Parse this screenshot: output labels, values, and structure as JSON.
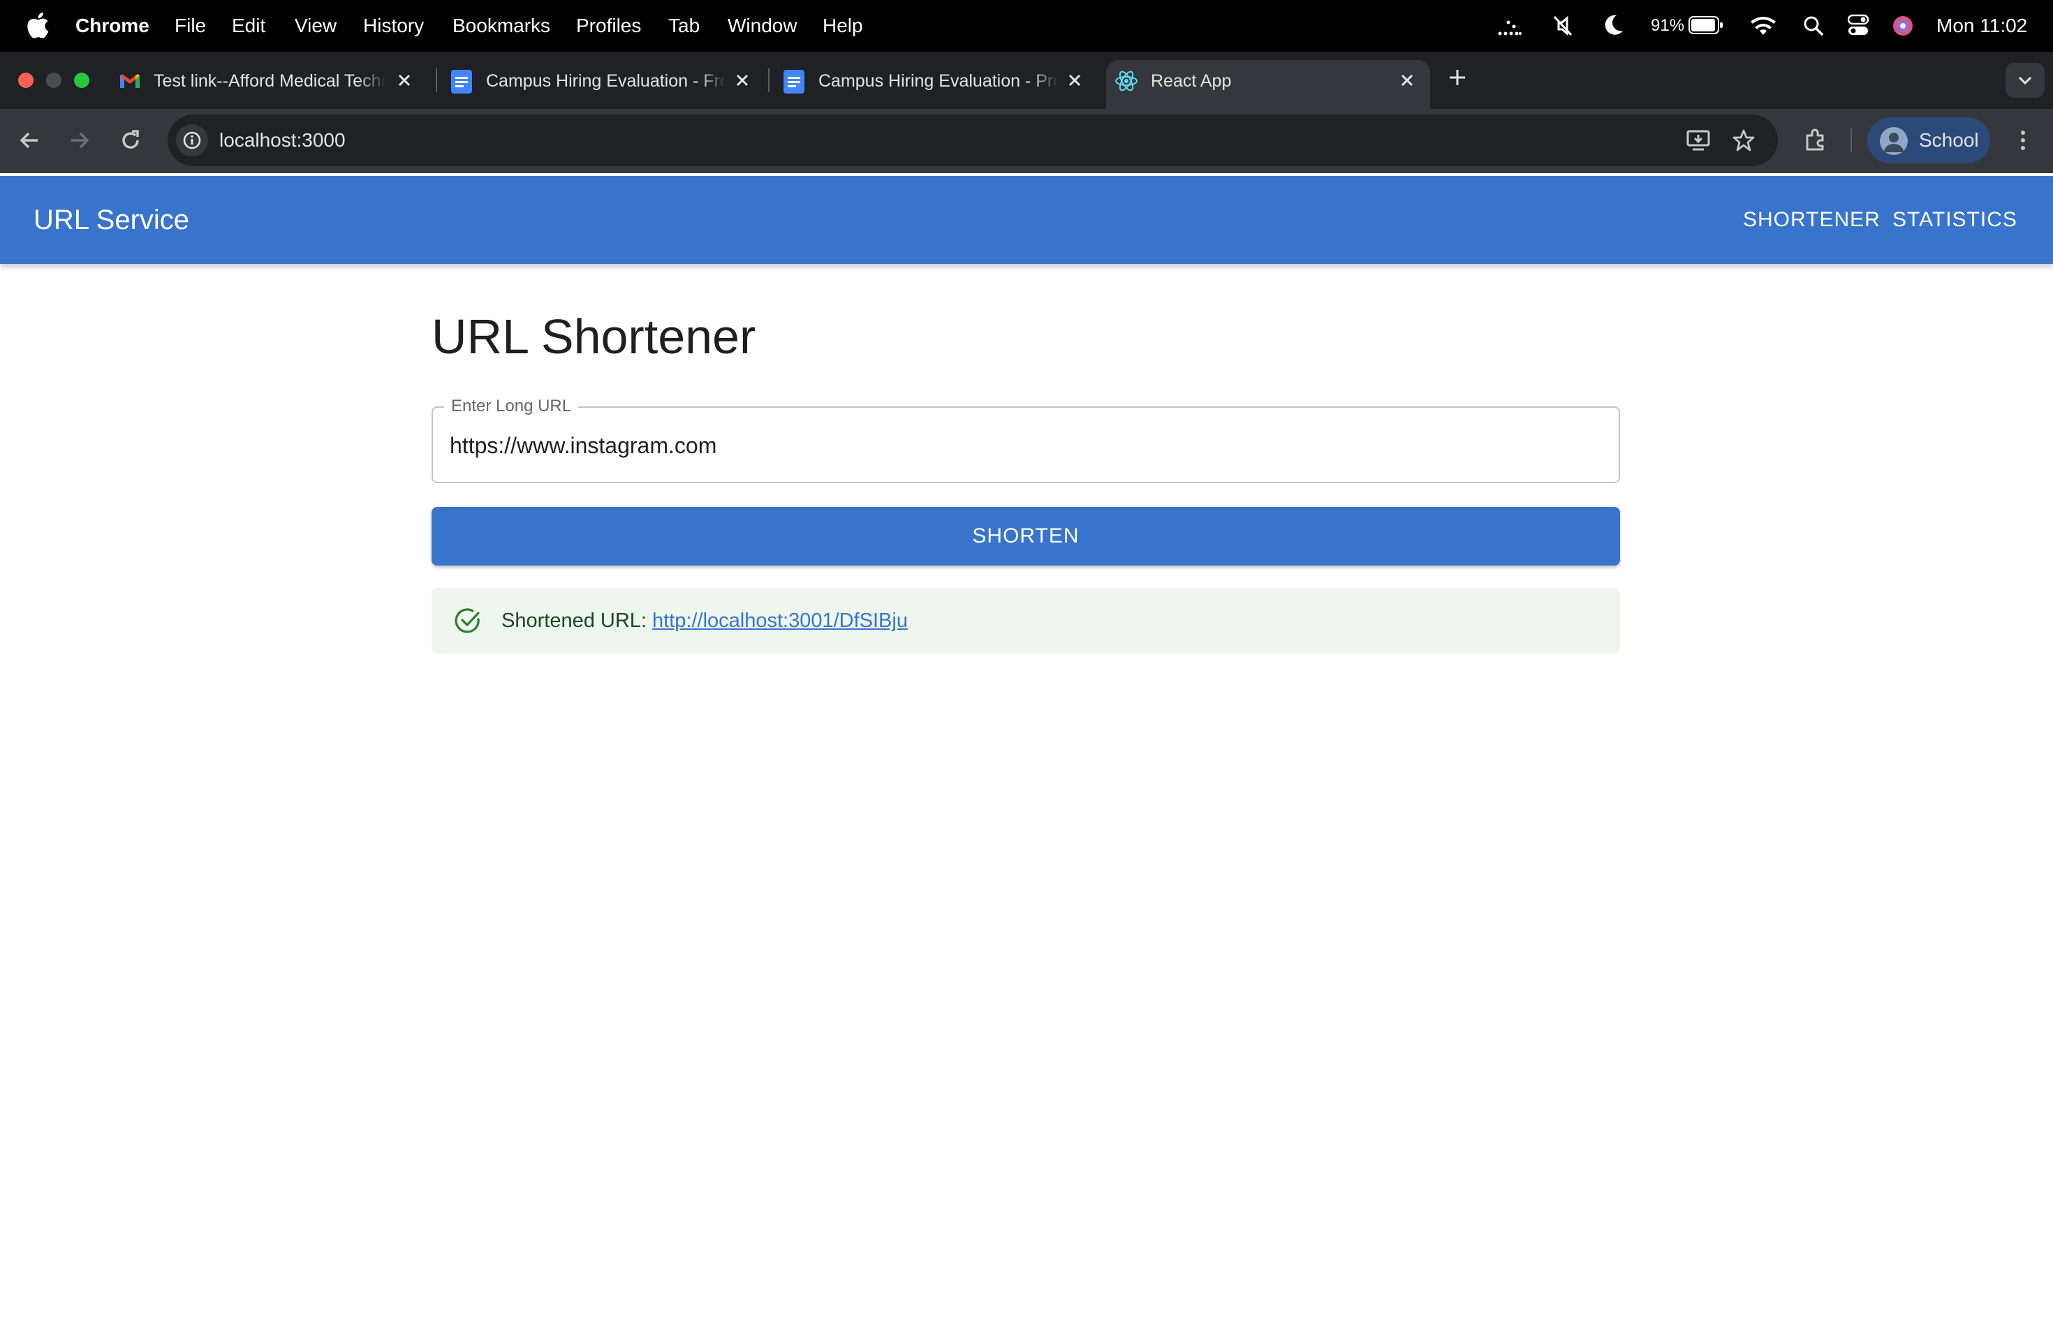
{
  "menubar": {
    "app_name": "Chrome",
    "menus": [
      "File",
      "Edit",
      "View",
      "History",
      "Bookmarks",
      "Profiles",
      "Tab",
      "Window",
      "Help"
    ],
    "battery": "91%",
    "clock": "Mon 11:02"
  },
  "tabs": [
    {
      "title": "Test link--Afford Medical Technologies",
      "icon": "gmail-icon",
      "active": false
    },
    {
      "title": "Campus Hiring Evaluation - Frontend",
      "icon": "docs-icon",
      "active": false
    },
    {
      "title": "Campus Hiring Evaluation - Product",
      "icon": "docs-icon",
      "active": false
    },
    {
      "title": "React App",
      "icon": "react-icon",
      "active": true
    }
  ],
  "toolbar": {
    "url": "localhost:3000",
    "profile_label": "School"
  },
  "app": {
    "title": "URL Service",
    "nav": [
      "SHORTENER",
      "STATISTICS"
    ],
    "page_title": "URL Shortener",
    "field_label": "Enter Long URL",
    "field_value": "https://www.instagram.com",
    "button_label": "SHORTEN",
    "alert_prefix": "Shortened URL:",
    "short_url": "http://localhost:3001/DfSIBju"
  },
  "colors": {
    "appbar": "#3874cb",
    "success_bg": "#edf7ed",
    "success_icon": "#2e7d32",
    "chrome_frame": "#1f2125",
    "chrome_toolbar": "#35373c"
  }
}
